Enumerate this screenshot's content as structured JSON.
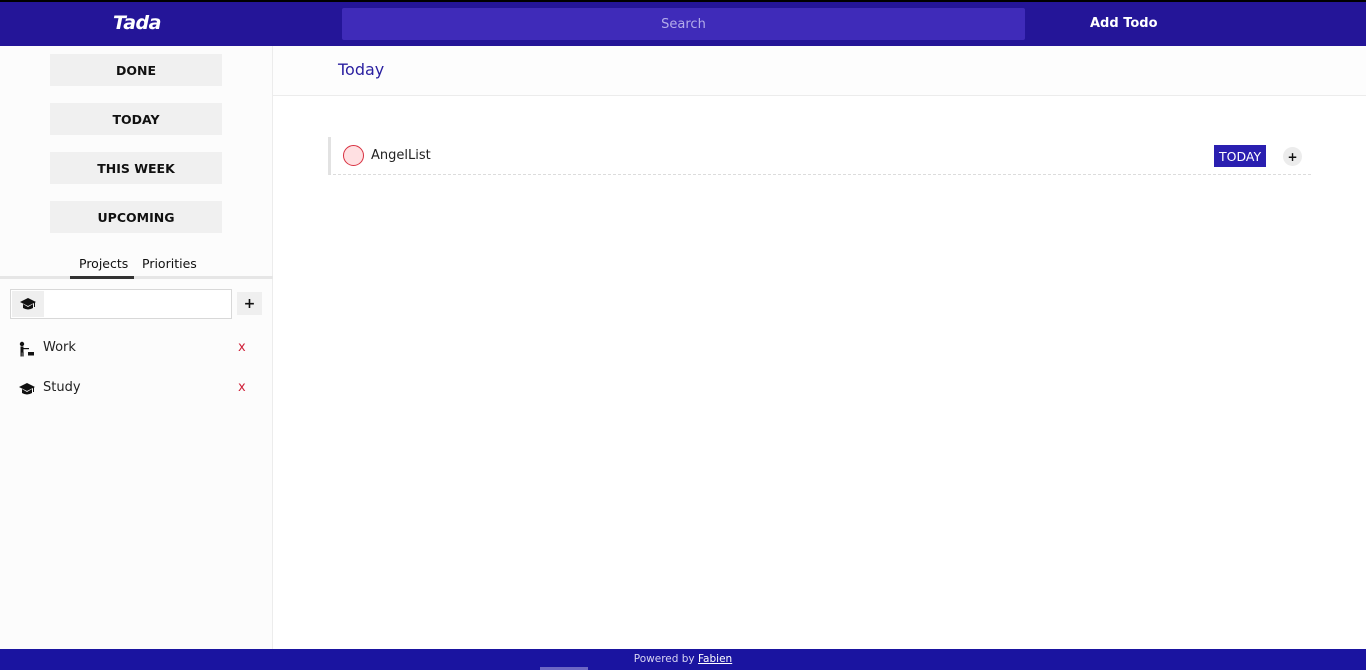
{
  "app": {
    "logo": "Tada"
  },
  "header": {
    "search_placeholder": "Search",
    "add_todo_label": "Add Todo"
  },
  "sidebar": {
    "nav": [
      {
        "label": "DONE"
      },
      {
        "label": "TODAY"
      },
      {
        "label": "THIS WEEK"
      },
      {
        "label": "UPCOMING"
      }
    ],
    "tabs": [
      {
        "label": "Projects",
        "active": true
      },
      {
        "label": "Priorities",
        "active": false
      }
    ],
    "project_input": {
      "value": "",
      "icon": "graduation-cap-icon",
      "add_label": "+"
    },
    "projects": [
      {
        "name": "Work",
        "icon": "worker-icon",
        "delete_label": "x"
      },
      {
        "name": "Study",
        "icon": "graduation-cap-icon",
        "delete_label": "x"
      }
    ]
  },
  "main": {
    "title": "Today",
    "todos": [
      {
        "text": "AngelList",
        "badge": "TODAY",
        "add_label": "+"
      }
    ]
  },
  "footer": {
    "text": "Powered by",
    "link": "Fabien"
  },
  "colors": {
    "topbar": "#241598",
    "search": "#3f2bb9",
    "accent": "#2a1fb0",
    "footer": "#1a14a0",
    "delete": "#d0223a"
  }
}
